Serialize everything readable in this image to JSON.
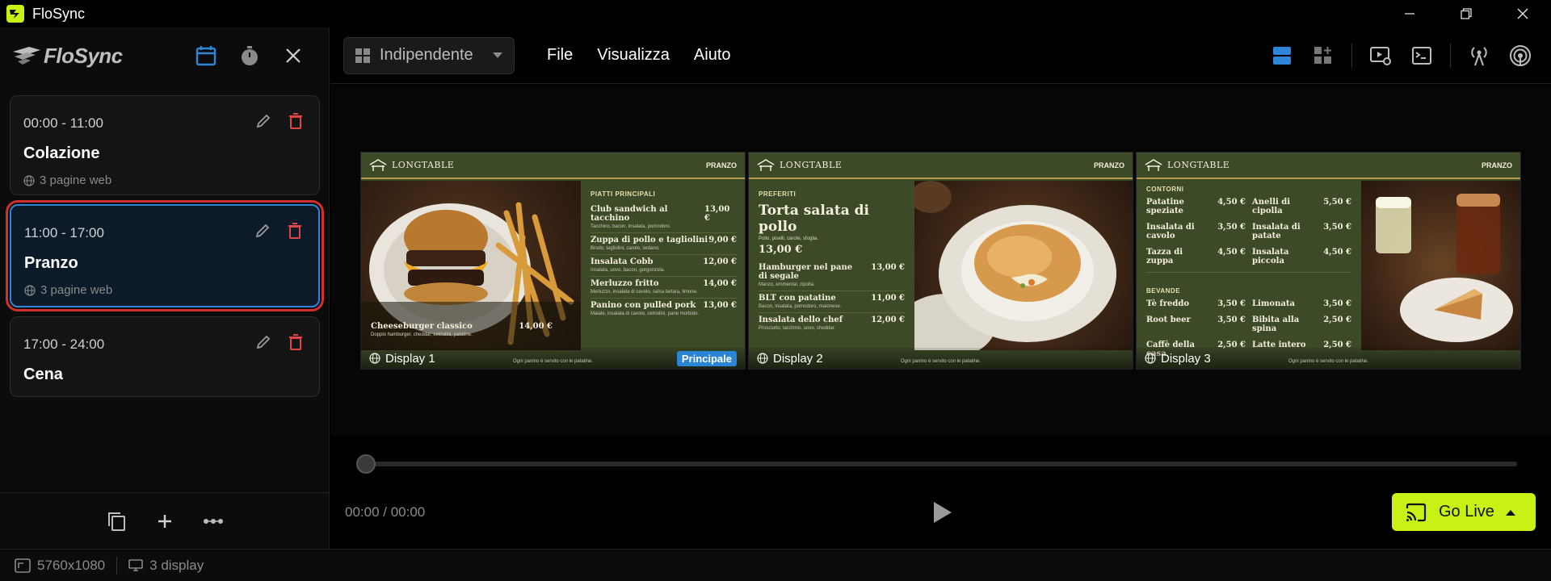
{
  "app": {
    "title": "FloSync",
    "brand": "FloSync"
  },
  "schedules": [
    {
      "time": "00:00 - 11:00",
      "name": "Colazione",
      "meta": "3 pagine web"
    },
    {
      "time": "11:00 - 17:00",
      "name": "Pranzo",
      "meta": "3 pagine web",
      "selected": true
    },
    {
      "time": "17:00 - 24:00",
      "name": "Cena",
      "meta": ""
    }
  ],
  "toolbar": {
    "mode": "Indipendente",
    "menu": [
      "File",
      "Visualizza",
      "Aiuto"
    ]
  },
  "displays": [
    {
      "label": "Display 1",
      "badge": "Principale",
      "brand": "LONGTABLE",
      "tag": "PRANZO",
      "section": "PIATTI PRINCIPALI",
      "feature": {
        "name": "Cheeseburger classico",
        "price": "14,00 €",
        "desc": "Doppio hamburger, cheddar, cetriolini, patatine."
      },
      "items": [
        {
          "name": "Club sandwich al tacchino",
          "price": "13,00 €",
          "desc": "Tacchino, bacon, insalata, pomodoro."
        },
        {
          "name": "Zuppa di pollo e tagliolini",
          "price": "9,00 €",
          "desc": "Brodo, tagliolini, carote, sedano."
        },
        {
          "name": "Insalata Cobb",
          "price": "12,00 €",
          "desc": "Insalata, uovo, bacon, gorgonzola."
        },
        {
          "name": "Merluzzo fritto",
          "price": "14,00 €",
          "desc": "Merluzzo, insalata di cavolo, salsa tartara, limone."
        },
        {
          "name": "Panino con pulled pork",
          "price": "13,00 €",
          "desc": "Maiale, insalata di cavolo, cetriolini, pane morbido."
        }
      ],
      "note": "Ogni panino è servito con le patatine."
    },
    {
      "label": "Display 2",
      "brand": "LONGTABLE",
      "tag": "PRANZO",
      "section": "PREFERITI",
      "feature": {
        "name": "Torta salata di pollo",
        "price": "13,00 €",
        "desc": "Pollo, piselli, carote, sfoglia."
      },
      "items": [
        {
          "name": "Hamburger nel pane di segale",
          "price": "13,00 €",
          "desc": "Manzo, emmental, cipolla."
        },
        {
          "name": "BLT con patatine",
          "price": "11,00 €",
          "desc": "Bacon, insalata, pomodoro, maionese."
        },
        {
          "name": "Insalata dello chef",
          "price": "12,00 €",
          "desc": "Prosciutto, tacchino, uovo, cheddar."
        }
      ],
      "note": "Ogni panino è servito con le patatine."
    },
    {
      "label": "Display 3",
      "brand": "LONGTABLE",
      "tag": "PRANZO",
      "section_a": "CONTORNI",
      "contorni": [
        {
          "name": "Patatine speziate",
          "price": "4,50 €"
        },
        {
          "name": "Anelli di cipolla",
          "price": "5,50 €"
        },
        {
          "name": "Insalata di cavolo",
          "price": "3,50 €"
        },
        {
          "name": "Insalata di patate",
          "price": "3,50 €"
        },
        {
          "name": "Tazza di zuppa",
          "price": "4,50 €"
        },
        {
          "name": "Insalata piccola",
          "price": "4,50 €"
        }
      ],
      "section_b": "BEVANDE",
      "bevande": [
        {
          "name": "Tè freddo",
          "price": "3,50 €"
        },
        {
          "name": "Limonata",
          "price": "3,50 €"
        },
        {
          "name": "Root beer",
          "price": "3,50 €"
        },
        {
          "name": "Bibita alla spina",
          "price": "2,50 €"
        },
        {
          "name": "Caffè della casa",
          "price": "2,50 €"
        },
        {
          "name": "Latte intero",
          "price": "2,50 €"
        }
      ],
      "note": "Ogni panino è servito con le patatine."
    }
  ],
  "transport": {
    "timecode": "00:00 / 00:00",
    "go_live": "Go Live",
    "progress": 0
  },
  "status": {
    "resolution": "5760x1080",
    "displays": "3 display"
  },
  "colors": {
    "accent": "#c8f215",
    "selection": "#2f86d8",
    "danger": "#e04545",
    "menu_bg": "#3d4a28"
  }
}
